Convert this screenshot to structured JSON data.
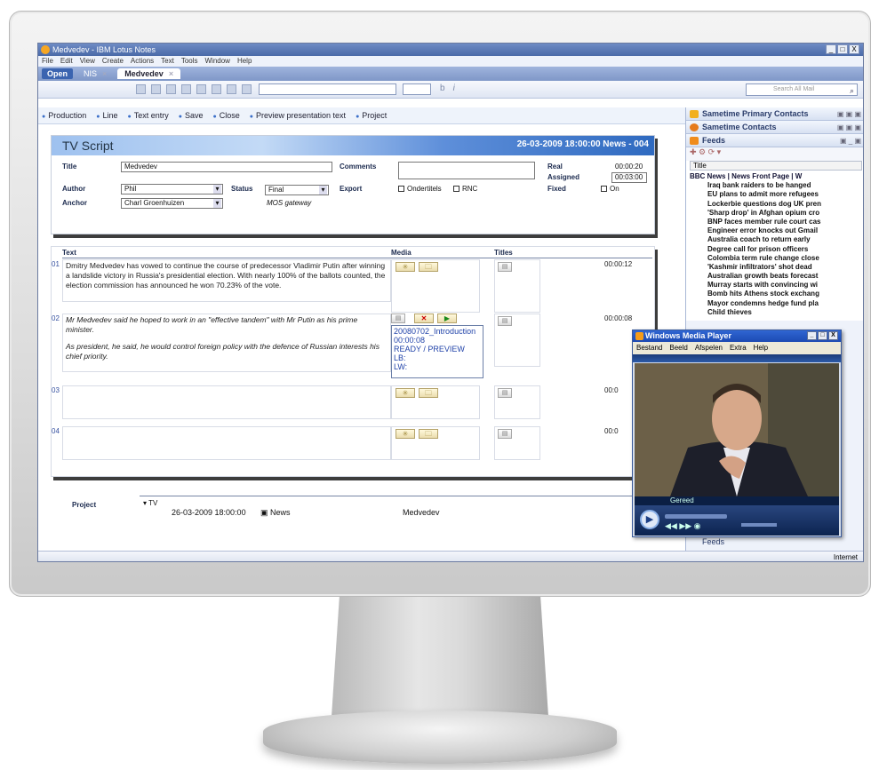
{
  "window": {
    "title": "Medvedev - IBM Lotus Notes",
    "controls": [
      "_",
      "□",
      "X"
    ]
  },
  "menu": [
    "File",
    "Edit",
    "View",
    "Create",
    "Actions",
    "Text",
    "Tools",
    "Window",
    "Help"
  ],
  "tabs": {
    "open_label": "Open",
    "items": [
      {
        "label": "NIS"
      },
      {
        "label": "Medvedev"
      }
    ],
    "close": "×"
  },
  "toolbar": {
    "format_glyphs": [
      "b",
      "i"
    ],
    "search_placeholder": "Search All Mail"
  },
  "actions": [
    "Production",
    "Line",
    "Text entry",
    "Save",
    "Close",
    "Preview presentation text",
    "Project"
  ],
  "script": {
    "heading": "TV Script",
    "datestamp": "26-03-2009 18:00:00 News - 004",
    "title_label": "Title",
    "title_value": "Medvedev",
    "comments_label": "Comments",
    "real_label": "Real",
    "real_value": "00:00:20",
    "assigned_label": "Assigned",
    "assigned_value": "00:03:00",
    "author_label": "Author",
    "author_value": "Phil",
    "status_label": "Status",
    "status_value": "Final",
    "export_label": "Export",
    "export_opt1": "Ondertitels",
    "export_opt2": "RNC",
    "fixed_label": "Fixed",
    "fixed_opt": "On",
    "anchor_label": "Anchor",
    "anchor_value": "Charl Groenhuizen",
    "mos_note": "MOS gateway"
  },
  "columns": {
    "text": "Text",
    "media": "Media",
    "titles": "Titles"
  },
  "rows": [
    {
      "num": "01",
      "text": "Dmitry Medvedev has vowed to continue the course of predecessor Vladimir Putin after winning a landslide victory in Russia's presidential election. With nearly 100% of the ballots counted, the election commission has announced he won 70.23% of the vote.",
      "duration": "00:00:12"
    },
    {
      "num": "02",
      "text": "Mr Medvedev said he hoped to work in an \"effective tandem\" with Mr Putin as his prime minister.",
      "text2": "As president, he said, he would control foreign policy with the defence of Russian interests his chief priority.",
      "duration": "00:00:08",
      "media_info": [
        "20080702_Introduction",
        "00:00:08",
        "READY / PREVIEW",
        "LB:",
        "LW:"
      ]
    },
    {
      "num": "03",
      "text": "",
      "duration": "00:0"
    },
    {
      "num": "04",
      "text": "",
      "duration": "00:0"
    }
  ],
  "project": {
    "label": "Project",
    "group": "TV",
    "date": "26-03-2009 18:00:00",
    "category": "News",
    "name": "Medvedev"
  },
  "statusbar": {
    "zone": "Internet"
  },
  "sidebar": {
    "primary_contacts": "Sametime Primary Contacts",
    "contacts": "Sametime Contacts",
    "feeds": "Feeds",
    "feeds_col": "Title",
    "feed_group": "BBC News | News Front Page | W",
    "feed_items": [
      "Iraq bank raiders to be hanged",
      "EU plans to admit more refugees",
      "Lockerbie questions dog UK pren",
      "'Sharp drop' in Afghan opium cro",
      "BNP faces member rule court cas",
      "Engineer error knocks out Gmail",
      "Australia coach to return early",
      "Degree call for prison officers",
      "Colombia term rule change close",
      "'Kashmir infiltrators' shot dead",
      "Australian growth beats forecast",
      "Murray starts with convincing wi",
      "Bomb hits Athens stock exchang",
      "Mayor condemns hedge fund pla",
      "Child thieves"
    ],
    "bottom": "Feeds"
  },
  "wmp": {
    "title": "Windows Media Player",
    "menu": [
      "Bestand",
      "Beeld",
      "Afspelen",
      "Extra",
      "Help"
    ],
    "status": "Gereed"
  },
  "colors": {
    "accent": "#3b6fc9",
    "titlebar": "#4a6aa8",
    "header_gradient_end": "#2f6ac0"
  }
}
